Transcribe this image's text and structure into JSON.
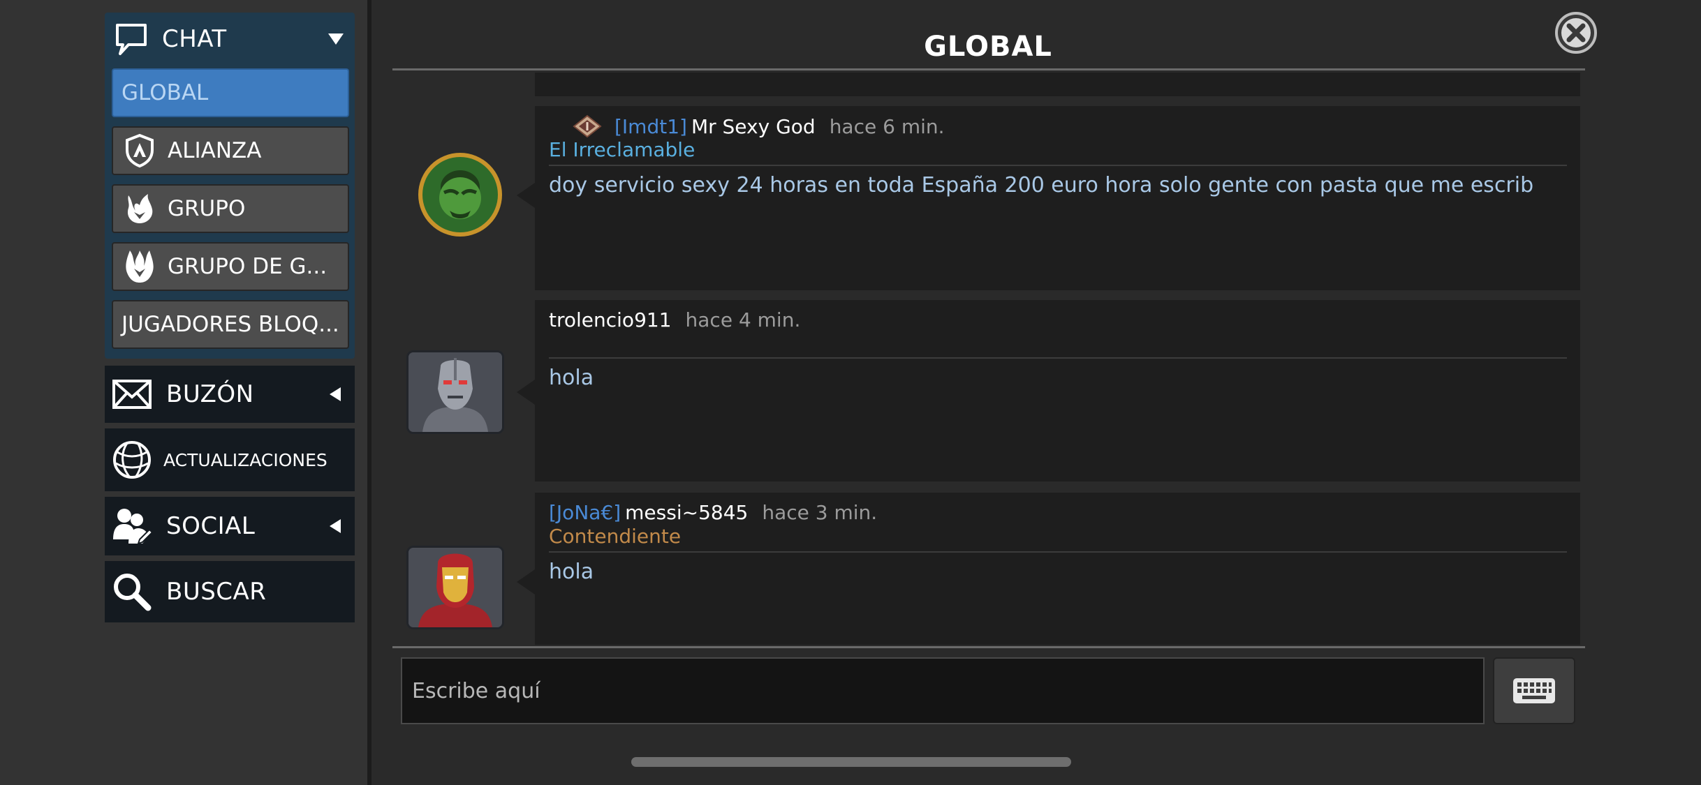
{
  "sidebar": {
    "chat": {
      "label": "CHAT",
      "icon": "speech-bubble-icon",
      "expanded": true
    },
    "chat_items": [
      {
        "label": "GLOBAL",
        "icon": null,
        "active": true
      },
      {
        "label": "ALIANZA",
        "icon": "alliance-shield-icon",
        "active": false
      },
      {
        "label": "GRUPO",
        "icon": "group-flame-icon",
        "active": false
      },
      {
        "label": "GRUPO DE G...",
        "icon": "group-war-flame-icon",
        "active": false
      },
      {
        "label": "JUGADORES BLOQ...",
        "icon": null,
        "active": false
      }
    ],
    "buzon": {
      "label": "BUZÓN",
      "icon": "envelope-icon"
    },
    "actualizaciones": {
      "label": "ACTUALIZACIONES",
      "icon": "globe-icon"
    },
    "social": {
      "label": "SOCIAL",
      "icon": "people-icon"
    },
    "buscar": {
      "label": "BUSCAR",
      "icon": "magnifier-icon"
    }
  },
  "chat_window": {
    "title": "GLOBAL",
    "close_icon": "close-icon"
  },
  "messages": [
    {
      "tag": "[Imdt1]",
      "username": "Mr Sexy God",
      "time": "hace 6 min.",
      "rank_title": "El Irreclamable",
      "rank_color": "#5ab0e0",
      "badge_icon": "rank-diamond-icon",
      "avatar": "hulk-avatar",
      "text": "doy servicio sexy 24 horas en toda España 200 euro hora solo gente con pasta que me escrib"
    },
    {
      "tag": "",
      "username": "trolencio911",
      "time": "hace 4 min.",
      "rank_title": "",
      "avatar": "ultron-avatar",
      "text": "hola"
    },
    {
      "tag": "[JoNa€]",
      "username": "messi~5845",
      "time": "hace 3 min.",
      "rank_title": "Contendiente",
      "rank_color": "#c28a4a",
      "avatar": "iron-man-avatar",
      "text": "hola"
    }
  ],
  "composer": {
    "placeholder": "Escribe aquí",
    "keyboard_icon": "keyboard-icon"
  },
  "colors": {
    "accent_blue": "#3e7cc0",
    "chat_panel": "#1f3a4d",
    "bubble": "#1e1e1e"
  }
}
